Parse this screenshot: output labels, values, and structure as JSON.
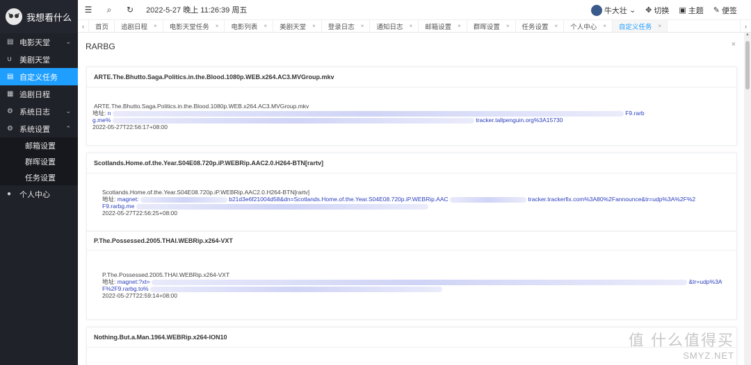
{
  "brand": {
    "name": "我想看什么"
  },
  "sidebar": {
    "items": [
      {
        "label": "电影天堂",
        "icon": "doc-icon",
        "glyph": "▤",
        "chevron": "⌄"
      },
      {
        "label": "美剧天堂",
        "icon": "magnet-icon",
        "glyph": "∪",
        "chevron": ""
      },
      {
        "label": "自定义任务",
        "icon": "doc-icon",
        "glyph": "▤",
        "chevron": ""
      },
      {
        "label": "追剧日程",
        "icon": "calendar-icon",
        "glyph": "▦",
        "chevron": ""
      },
      {
        "label": "系统日志",
        "icon": "gear-icon",
        "glyph": "⚙",
        "chevron": "⌄"
      },
      {
        "label": "系统设置",
        "icon": "gear-icon",
        "glyph": "⚙",
        "chevron": "⌃"
      },
      {
        "label": "个人中心",
        "icon": "user-icon",
        "glyph": "●",
        "chevron": ""
      }
    ],
    "submenu": [
      "邮箱设置",
      "群晖设置",
      "任务设置"
    ]
  },
  "header": {
    "menu_glyph": "☰",
    "search_glyph": "⌕",
    "refresh_glyph": "↻",
    "datetime": "2022-5-27 晚上 11:26:39 周五",
    "user": "牛大壮",
    "user_chevron": "⌄",
    "switch_label": "切换",
    "theme_label": "主题",
    "note_label": "便签",
    "switch_glyph": "✥",
    "theme_glyph": "▣",
    "note_glyph": "✎"
  },
  "tabs": {
    "left_arrow": "‹",
    "right_arrow": "›",
    "items": [
      {
        "label": "首页",
        "close": ""
      },
      {
        "label": "追剧日程",
        "close": "×"
      },
      {
        "label": "电影天堂任务",
        "close": "×"
      },
      {
        "label": "电影列表",
        "close": "×"
      },
      {
        "label": "美剧天堂",
        "close": "×"
      },
      {
        "label": "登录日志",
        "close": "×"
      },
      {
        "label": "通知日志",
        "close": "×"
      },
      {
        "label": "邮箱设置",
        "close": "×"
      },
      {
        "label": "群晖设置",
        "close": "×"
      },
      {
        "label": "任务设置",
        "close": "×"
      },
      {
        "label": "个人中心",
        "close": "×"
      },
      {
        "label": "自定义任务",
        "close": "×"
      }
    ]
  },
  "panel": {
    "title": "RARBG",
    "close": "×"
  },
  "cards": [
    {
      "title": "ARTE.The.Bhutto.Saga.Politics.in.the.Blood.1080p.WEB.x264.AC3.MVGroup.mkv",
      "name": "ARTE.The.Bhutto.Saga.Politics.in.the.Blood.1080p.WEB.x264.AC3.MVGroup.mkv",
      "addr_label": "地址:",
      "addr_start": "n",
      "addr_end": "F9.rarb",
      "cont_start": "g.me%",
      "cont_end": "tracker.tallpenguin.org%3A15730",
      "date": "2022-05-27T22:56:17+08:00"
    },
    {
      "title": "Scotlands.Home.of.the.Year.S04E08.720p.iP.WEBRip.AAC2.0.H264-BTN[rartv]",
      "name": "Scotlands.Home.of.the.Year.S04E08.720p.iP.WEBRip.AAC2.0.H264-BTN[rartv]",
      "addr_label": "地址:",
      "addr_start": "magnet:",
      "addr_mid": "b21d3e6f21004d58&dn=Scotlands.Home.of.the.Year.S04E08.720p.iP.WEBRip.AAC",
      "addr_end": "tracker.trackerfix.com%3A80%2Fannounce&tr=udp%3A%2F%2",
      "cont_start": "F9.rarbg.me",
      "cont_end": "",
      "date": "2022-05-27T22:56:25+08:00"
    },
    {
      "title": "P.The.Possessed.2005.THAI.WEBRip.x264-VXT",
      "name": "P.The.Possessed.2005.THAI.WEBRip.x264-VXT",
      "addr_label": "地址:",
      "addr_start": "magnet:?xt=",
      "addr_end": "&tr=udp%3A%2",
      "cont_start": "F%2F9.rarbg.to%",
      "cont_end": "",
      "date": "2022-05-27T22:59:14+08:00"
    },
    {
      "title": "Nothing.But.a.Man.1964.WEBRip.x264-ION10"
    }
  ],
  "watermark": {
    "big": "值 什么值得买",
    "small": "SMYZ.NET"
  }
}
